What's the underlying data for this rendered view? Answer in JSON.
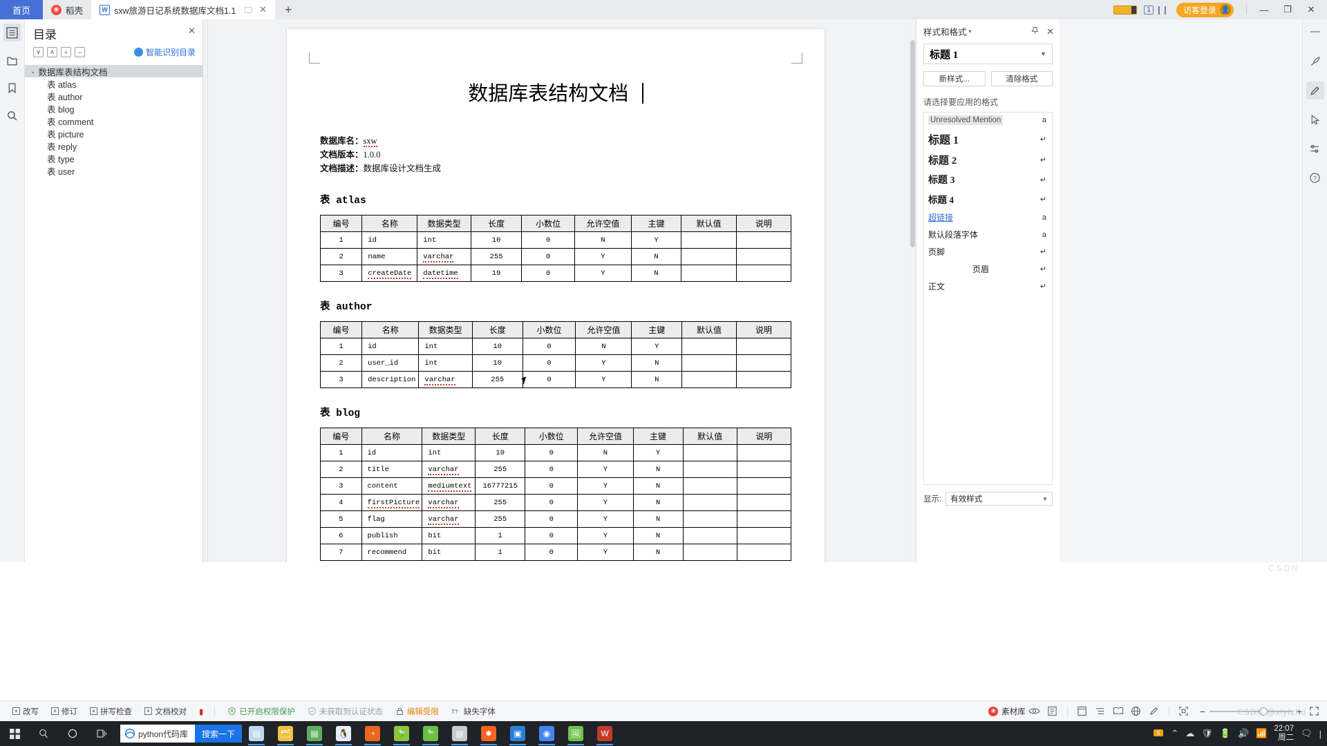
{
  "titlebar": {
    "home_tab": "首页",
    "docer_tab": "稻壳",
    "doc_tab": "sxw旅游日记系统数据库文档1.1",
    "new_tab": "+",
    "page_indicator": "1",
    "login_label": "访客登录",
    "minimize": "—",
    "restore": "❐",
    "close": "✕"
  },
  "left_rail": [
    {
      "name": "outline-icon",
      "glyph": "▤"
    },
    {
      "name": "folder-icon",
      "glyph": "🗀"
    },
    {
      "name": "bookmark-icon",
      "glyph": "🔖"
    },
    {
      "name": "search-icon",
      "glyph": "🔍"
    }
  ],
  "outline": {
    "title": "目录",
    "close": "✕",
    "tools": [
      "∨",
      "∧",
      "+",
      "−"
    ],
    "smart_label": "智能识别目录",
    "root": "数据库表结构文档",
    "items": [
      "表 atlas",
      "表 author",
      "表 blog",
      "表 comment",
      "表 picture",
      "表 reply",
      "表 type",
      "表 user"
    ]
  },
  "document": {
    "title": "数据库表结构文档",
    "meta": [
      {
        "label": "数据库名：",
        "value": "sxw",
        "spell_error": true
      },
      {
        "label": "文档版本：",
        "value": "1.0.0",
        "spell_error": false
      },
      {
        "label": "文档描述：",
        "value": "数据库设计文档生成",
        "spell_error": false
      }
    ],
    "columns": [
      "编号",
      "名称",
      "数据类型",
      "长度",
      "小数位",
      "允许空值",
      "主键",
      "默认值",
      "说明"
    ],
    "tables": [
      {
        "heading_prefix": "表",
        "heading_name": "atlas",
        "rows": [
          [
            "1",
            "id",
            "int",
            "10",
            "0",
            "N",
            "Y",
            "",
            ""
          ],
          [
            "2",
            "name",
            "varchar",
            "255",
            "0",
            "Y",
            "N",
            "",
            ""
          ],
          [
            "3",
            "createDate",
            "datetime",
            "19",
            "0",
            "Y",
            "N",
            "",
            ""
          ]
        ],
        "squiggle": [
          [],
          [
            "type"
          ],
          [
            "name",
            "type"
          ]
        ]
      },
      {
        "heading_prefix": "表",
        "heading_name": "author",
        "rows": [
          [
            "1",
            "id",
            "int",
            "10",
            "0",
            "N",
            "Y",
            "",
            ""
          ],
          [
            "2",
            "user_id",
            "int",
            "10",
            "0",
            "Y",
            "N",
            "",
            ""
          ],
          [
            "3",
            "description",
            "varchar",
            "255",
            "0",
            "Y",
            "N",
            "",
            ""
          ]
        ],
        "squiggle": [
          [],
          [],
          [
            "type"
          ]
        ]
      },
      {
        "heading_prefix": "表",
        "heading_name": "blog",
        "rows": [
          [
            "1",
            "id",
            "int",
            "10",
            "0",
            "N",
            "Y",
            "",
            ""
          ],
          [
            "2",
            "title",
            "varchar",
            "255",
            "0",
            "Y",
            "N",
            "",
            ""
          ],
          [
            "3",
            "content",
            "mediumtext",
            "16777215",
            "0",
            "Y",
            "N",
            "",
            ""
          ],
          [
            "4",
            "firstPicture",
            "varchar",
            "255",
            "0",
            "Y",
            "N",
            "",
            ""
          ],
          [
            "5",
            "flag",
            "varchar",
            "255",
            "0",
            "Y",
            "N",
            "",
            ""
          ],
          [
            "6",
            "publish",
            "bit",
            "1",
            "0",
            "Y",
            "N",
            "",
            ""
          ],
          [
            "7",
            "recommend",
            "bit",
            "1",
            "0",
            "Y",
            "N",
            "",
            ""
          ]
        ],
        "squiggle": [
          [],
          [
            "type"
          ],
          [
            "type"
          ],
          [
            "name",
            "type"
          ],
          [
            "type"
          ],
          [],
          []
        ]
      }
    ]
  },
  "styles_panel": {
    "header": "样式和格式",
    "pin_icon": "📌",
    "close_icon": "✕",
    "current_style": "标题 1",
    "new_style_button": "新样式...",
    "clear_format_button": "清除格式",
    "hint": "请选择要应用的格式",
    "items": [
      {
        "label": "Unresolved Mention",
        "mark": "a",
        "kind": "mention"
      },
      {
        "label": "标题 1",
        "mark": "↵",
        "kind": "h1"
      },
      {
        "label": "标题 2",
        "mark": "↵",
        "kind": "h2"
      },
      {
        "label": "标题 3",
        "mark": "↵",
        "kind": "h3"
      },
      {
        "label": "标题 4",
        "mark": "↵",
        "kind": "h4"
      },
      {
        "label": "超链接",
        "mark": "a",
        "kind": "link"
      },
      {
        "label": "默认段落字体",
        "mark": "a",
        "kind": "plain"
      },
      {
        "label": "页脚",
        "mark": "↵",
        "kind": "plain"
      },
      {
        "label": "页眉",
        "mark": "↵",
        "kind": "indent"
      },
      {
        "label": "正文",
        "mark": "↵",
        "kind": "plain"
      }
    ],
    "show_label": "显示:",
    "show_value": "有效样式"
  },
  "right_rail": [
    {
      "name": "rocket-icon",
      "glyph": "🚀"
    },
    {
      "name": "pen-style-icon",
      "glyph": "✎"
    },
    {
      "name": "select-cursor-icon",
      "glyph": "↖"
    },
    {
      "name": "settings-slider-icon",
      "glyph": "⚙"
    },
    {
      "name": "help-icon",
      "glyph": "?"
    }
  ],
  "statusbar": {
    "left_items": [
      {
        "label": "改写",
        "box": "×",
        "color": "normal"
      },
      {
        "label": "修订",
        "box": "×",
        "color": "normal"
      },
      {
        "label": "拼写检查",
        "box": "×",
        "color": "normal"
      },
      {
        "label": "文档校对",
        "box": "×",
        "color": "normal"
      }
    ],
    "badge": "▮",
    "protection": "已开启权限保护",
    "auth": "未获取到认证状态",
    "edit_limit": "编辑受限",
    "missing_font": "缺失字体",
    "material_library": "素材库",
    "zoom_minus": "−",
    "zoom_plus": "+",
    "zoom_value": "",
    "right_icons": [
      "eye-icon",
      "page-layout-icon",
      "web-layout-icon",
      "outline-view-icon",
      "reading-view-icon",
      "web-icon",
      "pen-icon",
      "fullscreen-icon",
      "expand-icon"
    ]
  },
  "taskbar": {
    "start": "⊞",
    "search_icon": "🔍",
    "cortana_icon": "◯",
    "taskview_icon": "❑",
    "browser_label": "python代码库",
    "search_button": "搜索一下",
    "apps": [
      {
        "name": "notes-app",
        "glyph": "▤",
        "color": "#bdd7ee"
      },
      {
        "name": "file-explorer",
        "glyph": "🗂",
        "color": "#f0c040"
      },
      {
        "name": "wps-note",
        "glyph": "▤",
        "color": "#5fae5f"
      },
      {
        "name": "qq-app",
        "glyph": "🐧",
        "color": "#e8eef5"
      },
      {
        "name": "firefox-app",
        "glyph": "◔",
        "color": "#e8681e"
      },
      {
        "name": "green-app",
        "glyph": "🍃",
        "color": "#8cc63f"
      },
      {
        "name": "leaf-app",
        "glyph": "🍃",
        "color": "#6abf45"
      },
      {
        "name": "reader-app",
        "glyph": "▤",
        "color": "#c7ccd1"
      },
      {
        "name": "settings-app",
        "glyph": "✸",
        "color": "#f26522"
      },
      {
        "name": "video-app",
        "glyph": "▣",
        "color": "#2980d9"
      },
      {
        "name": "chrome-app",
        "glyph": "◉",
        "color": "#4285f4"
      },
      {
        "name": "photos-app",
        "glyph": "🖼",
        "color": "#6fc24a"
      },
      {
        "name": "wps-writer",
        "glyph": "W",
        "color": "#c0392b"
      }
    ],
    "tray": [
      "ime-icon",
      "network-icon",
      "bluetooth-icon",
      "cloud-icon",
      "chevron-up-icon",
      "battery-icon",
      "volume-icon",
      "sound-icon"
    ],
    "clock_time": "22:07",
    "clock_date": "周二",
    "show_desktop": "|"
  }
}
